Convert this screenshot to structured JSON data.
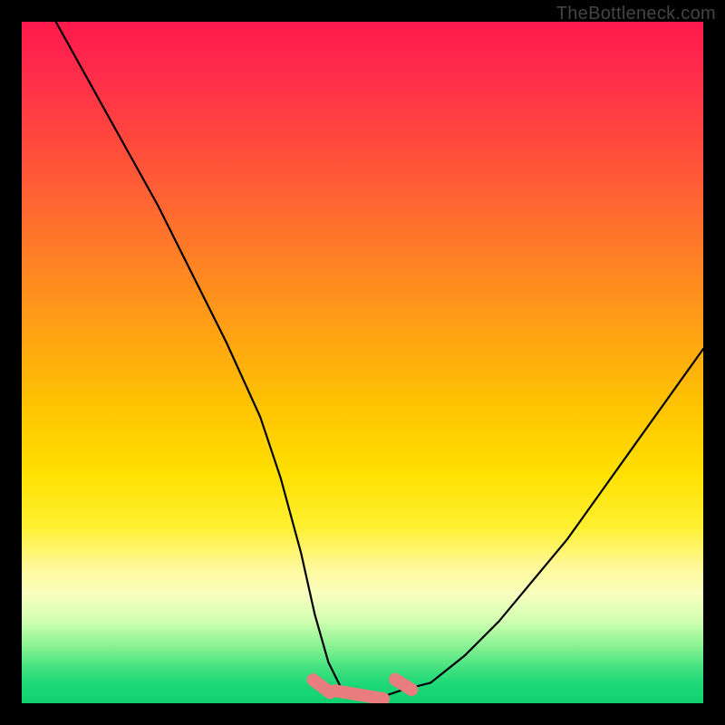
{
  "watermark": "TheBottleneck.com",
  "chart_data": {
    "type": "line",
    "title": "",
    "xlabel": "",
    "ylabel": "",
    "xlim": [
      0,
      100
    ],
    "ylim": [
      0,
      100
    ],
    "series": [
      {
        "name": "curve",
        "x": [
          5,
          10,
          15,
          20,
          25,
          30,
          35,
          38,
          41,
          43,
          45,
          47,
          49,
          50,
          51,
          53,
          56,
          60,
          65,
          70,
          75,
          80,
          85,
          90,
          95,
          100
        ],
        "values": [
          100,
          91,
          82,
          73,
          63,
          53,
          42,
          33,
          22,
          13,
          6,
          2,
          1,
          1,
          1,
          1,
          2,
          3,
          7,
          12,
          18,
          24,
          31,
          38,
          45,
          52
        ]
      }
    ],
    "markers": [
      {
        "name": "blob-left",
        "x_range": [
          42,
          46
        ],
        "y_range": [
          1,
          4
        ]
      },
      {
        "name": "blob-mid",
        "x_range": [
          45,
          54
        ],
        "y_range": [
          0.5,
          2
        ]
      },
      {
        "name": "blob-right",
        "x_range": [
          54,
          58
        ],
        "y_range": [
          1.5,
          4
        ]
      }
    ],
    "colors": {
      "background": "#000000",
      "curve": "#000000",
      "marker": "#e97c7c",
      "gradient_top": "#ff1a4d",
      "gradient_bottom": "#10d070"
    }
  }
}
